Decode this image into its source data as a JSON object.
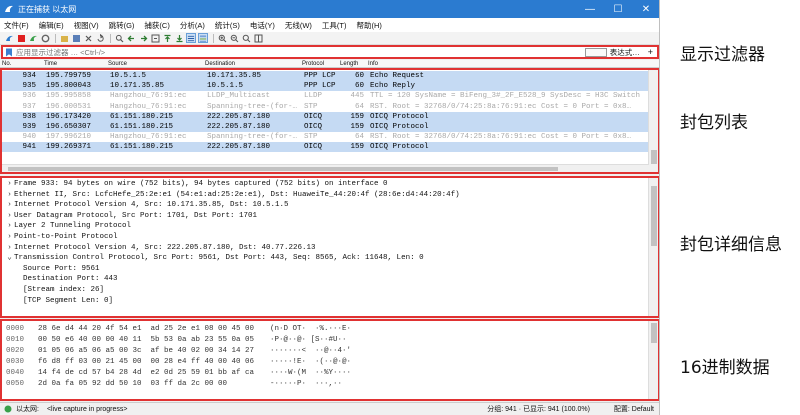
{
  "window": {
    "title": "正在捕获 以太网",
    "controls": [
      "—",
      "☐",
      "✕"
    ]
  },
  "menu": [
    "文件(F)",
    "编辑(E)",
    "视图(V)",
    "跳转(G)",
    "捕获(C)",
    "分析(A)",
    "统计(S)",
    "电话(Y)",
    "无线(W)",
    "工具(T)",
    "帮助(H)"
  ],
  "filter": {
    "placeholder": "应用显示过滤器 … <Ctrl-/>",
    "expression_label": "表达式…",
    "plus": "+"
  },
  "columns": [
    "No.",
    "Time",
    "Source",
    "Destination",
    "Protocol",
    "Length",
    "Info"
  ],
  "packets": [
    {
      "no": "934",
      "time": "195.799759",
      "src": "10.5.1.5",
      "dst": "10.171.35.85",
      "proto": "PPP LCP",
      "len": "60",
      "info": "Echo Request",
      "style": "ppp"
    },
    {
      "no": "935",
      "time": "195.800043",
      "src": "10.171.35.85",
      "dst": "10.5.1.5",
      "proto": "PPP LCP",
      "len": "60",
      "info": "Echo Reply",
      "style": "ppp"
    },
    {
      "no": "936",
      "time": "195.995858",
      "src": "Hangzhou_76:91:ec",
      "dst": "LLDP_Multicast",
      "proto": "LLDP",
      "len": "445",
      "info": "TTL = 120 SysName = BiFeng_3#_2F_E528_9 SysDesc = H3C Switch",
      "style": "faded"
    },
    {
      "no": "937",
      "time": "196.000531",
      "src": "Hangzhou_76:91:ec",
      "dst": "Spanning-tree-(for-…",
      "proto": "STP",
      "len": "64",
      "info": "RST. Root = 32768/0/74:25:8a:76:91:ec  Cost = 0  Port = 0x8…",
      "style": "faded"
    },
    {
      "no": "938",
      "time": "196.173420",
      "src": "61.151.180.215",
      "dst": "222.205.87.180",
      "proto": "OICQ",
      "len": "159",
      "info": "OICQ Protocol",
      "style": "oicq"
    },
    {
      "no": "939",
      "time": "196.650307",
      "src": "61.151.180.215",
      "dst": "222.205.87.180",
      "proto": "OICQ",
      "len": "159",
      "info": "OICQ Protocol",
      "style": "oicq"
    },
    {
      "no": "940",
      "time": "197.996210",
      "src": "Hangzhou_76:91:ec",
      "dst": "Spanning-tree-(for-…",
      "proto": "STP",
      "len": "64",
      "info": "RST. Root = 32768/0/74:25:8a:76:91:ec  Cost = 0  Port = 0x8…",
      "style": "faded"
    },
    {
      "no": "941",
      "time": "199.269371",
      "src": "61.151.180.215",
      "dst": "222.205.87.180",
      "proto": "OICQ",
      "len": "159",
      "info": "OICQ Protocol",
      "style": "oicq"
    }
  ],
  "details": [
    {
      "text": "Frame 933: 94 bytes on wire (752 bits), 94 bytes captured (752 bits) on interface 0",
      "level": 0,
      "arrow": "›"
    },
    {
      "text": "Ethernet II, Src: LcfcHefe_25:2e:e1 (54:e1:ad:25:2e:e1), Dst: HuaweiTe_44:20:4f (28:6e:d4:44:20:4f)",
      "level": 0,
      "arrow": "›"
    },
    {
      "text": "Internet Protocol Version 4, Src: 10.171.35.85, Dst: 10.5.1.5",
      "level": 0,
      "arrow": "›"
    },
    {
      "text": "User Datagram Protocol, Src Port: 1701, Dst Port: 1701",
      "level": 0,
      "arrow": "›"
    },
    {
      "text": "Layer 2 Tunneling Protocol",
      "level": 0,
      "arrow": "›"
    },
    {
      "text": "Point-to-Point Protocol",
      "level": 0,
      "arrow": "›"
    },
    {
      "text": "Internet Protocol Version 4, Src: 222.205.87.180, Dst: 40.77.226.13",
      "level": 0,
      "arrow": "›"
    },
    {
      "text": "Transmission Control Protocol, Src Port: 9561, Dst Port: 443, Seq: 8565, Ack: 11648, Len: 0",
      "level": 0,
      "arrow": "⌄"
    },
    {
      "text": "Source Port: 9561",
      "level": 1,
      "arrow": ""
    },
    {
      "text": "Destination Port: 443",
      "level": 1,
      "arrow": ""
    },
    {
      "text": "[Stream index: 26]",
      "level": 1,
      "arrow": ""
    },
    {
      "text": "[TCP Segment Len: 0]",
      "level": 1,
      "arrow": ""
    }
  ],
  "hex": [
    {
      "off": "0000",
      "bytes": "28 6e d4 44 20 4f 54 e1  ad 25 2e e1 08 00 45 00",
      "ascii": "(n·D OT·  ·%.···E·"
    },
    {
      "off": "0010",
      "bytes": "00 50 e6 40 00 00 40 11  5b 53 0a ab 23 55 0a 05",
      "ascii": "·P·@··@· [S··#U··"
    },
    {
      "off": "0020",
      "bytes": "01 05 06 a5 06 a5 00 3c  af be 40 02 00 34 14 27",
      "ascii": "·······<  ··@··4·'"
    },
    {
      "off": "0030",
      "bytes": "f6 d8 ff 03 00 21 45 00  00 28 e4 ff 40 00 40 06",
      "ascii": "·····!E·  ·(··@·@·"
    },
    {
      "off": "0040",
      "bytes": "14 f4 de cd 57 b4 28 4d  e2 0d 25 59 01 bb af ca",
      "ascii": "····W·(M  ··%Y····"
    },
    {
      "off": "0050",
      "bytes": "2d 0a fa 05 92 dd 50 10  03 ff da 2c 00 00",
      "ascii": "-·····P·  ···,··"
    }
  ],
  "status": {
    "iface": "以太网:",
    "capture": "<live capture in progress>",
    "packets": "分组: 941 · 已显示: 941 (100.0%)",
    "profile": "配置: Default"
  },
  "annotations": {
    "filter": "显示过滤器",
    "list": "封包列表",
    "detail": "封包详细信息",
    "hex": "16进制数据"
  },
  "colors": {
    "titlebar": "#2b7bd0",
    "highlight_box": "#e03232",
    "row_blue": "#c5daf3",
    "faded_text": "#a9a9a9"
  }
}
